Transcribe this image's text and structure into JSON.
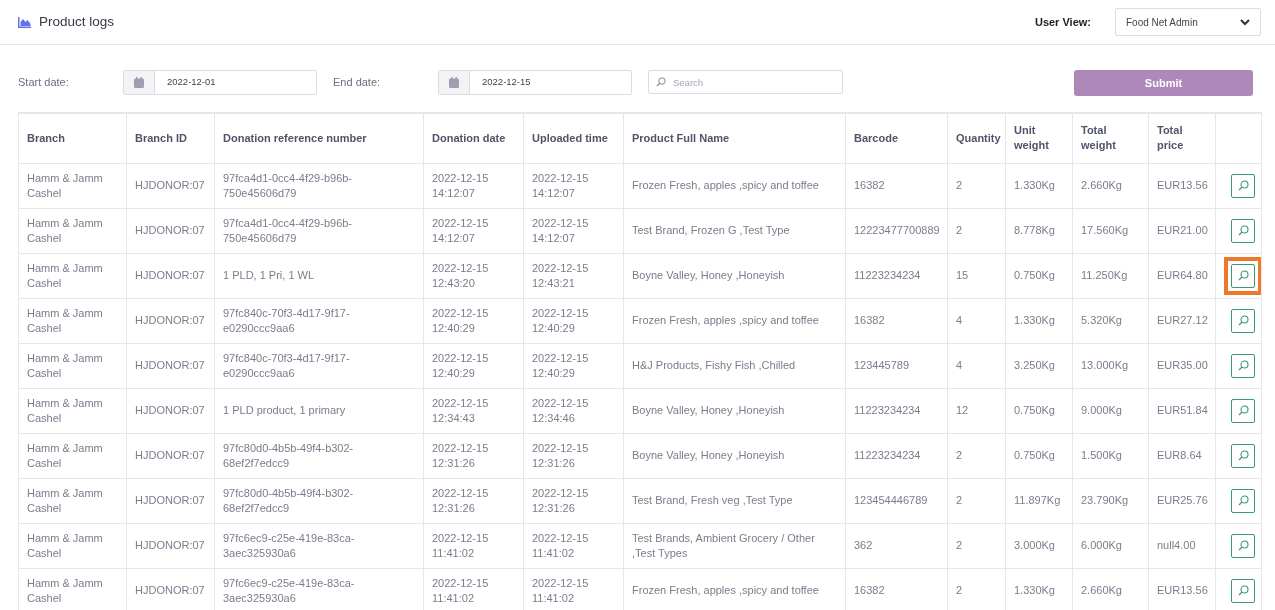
{
  "header": {
    "title": "Product logs",
    "user_view_label": "User View:",
    "user_view_value": "Food Net Admin"
  },
  "filters": {
    "start_label": "Start date:",
    "start_value": "2022-12-01",
    "end_label": "End date:",
    "end_value": "2022-12-15",
    "search_placeholder": "Search",
    "submit": "Submit"
  },
  "table": {
    "columns": [
      "Branch",
      "Branch ID",
      "Donation reference number",
      "Donation date",
      "Uploaded time",
      "Product Full Name",
      "Barcode",
      "Quantity",
      "Unit weight",
      "Total weight",
      "Total price"
    ],
    "rows": [
      {
        "cells": [
          "Hamm & Jamm Cashel",
          "HJDONOR:07",
          "97fca4d1-0cc4-4f29-b96b-750e45606d79",
          "2022-12-15 14:12:07",
          "2022-12-15 14:12:07",
          "Frozen Fresh, apples ,spicy and toffee",
          "16382",
          "2",
          "1.330Kg",
          "2.660Kg",
          "EUR13.56"
        ],
        "highlighted": false
      },
      {
        "cells": [
          "Hamm & Jamm Cashel",
          "HJDONOR:07",
          "97fca4d1-0cc4-4f29-b96b-750e45606d79",
          "2022-12-15 14:12:07",
          "2022-12-15 14:12:07",
          "Test Brand, Frozen G ,Test Type",
          "12223477700889",
          "2",
          "8.778Kg",
          "17.560Kg",
          "EUR21.00"
        ],
        "highlighted": false
      },
      {
        "cells": [
          "Hamm & Jamm Cashel",
          "HJDONOR:07",
          "1 PLD, 1 Pri, 1 WL",
          "2022-12-15 12:43:20",
          "2022-12-15 12:43:21",
          "Boyne Valley, Honey ,Honeyish",
          "11223234234",
          "15",
          "0.750Kg",
          "11.250Kg",
          "EUR64.80"
        ],
        "highlighted": true
      },
      {
        "cells": [
          "Hamm & Jamm Cashel",
          "HJDONOR:07",
          "97fc840c-70f3-4d17-9f17-e0290ccc9aa6",
          "2022-12-15 12:40:29",
          "2022-12-15 12:40:29",
          "Frozen Fresh, apples ,spicy and toffee",
          "16382",
          "4",
          "1.330Kg",
          "5.320Kg",
          "EUR27.12"
        ],
        "highlighted": false
      },
      {
        "cells": [
          "Hamm & Jamm Cashel",
          "HJDONOR:07",
          "97fc840c-70f3-4d17-9f17-e0290ccc9aa6",
          "2022-12-15 12:40:29",
          "2022-12-15 12:40:29",
          "H&J Products, Fishy Fish ,Chilled",
          "123445789",
          "4",
          "3.250Kg",
          "13.000Kg",
          "EUR35.00"
        ],
        "highlighted": false
      },
      {
        "cells": [
          "Hamm & Jamm Cashel",
          "HJDONOR:07",
          "1 PLD product, 1 primary",
          "2022-12-15 12:34:43",
          "2022-12-15 12:34:46",
          "Boyne Valley, Honey ,Honeyish",
          "11223234234",
          "12",
          "0.750Kg",
          "9.000Kg",
          "EUR51.84"
        ],
        "highlighted": false
      },
      {
        "cells": [
          "Hamm & Jamm Cashel",
          "HJDONOR:07",
          "97fc80d0-4b5b-49f4-b302-68ef2f7edcc9",
          "2022-12-15 12:31:26",
          "2022-12-15 12:31:26",
          "Boyne Valley, Honey ,Honeyish",
          "11223234234",
          "2",
          "0.750Kg",
          "1.500Kg",
          "EUR8.64"
        ],
        "highlighted": false
      },
      {
        "cells": [
          "Hamm & Jamm Cashel",
          "HJDONOR:07",
          "97fc80d0-4b5b-49f4-b302-68ef2f7edcc9",
          "2022-12-15 12:31:26",
          "2022-12-15 12:31:26",
          "Test Brand, Fresh veg ,Test Type",
          "123454446789",
          "2",
          "11.897Kg",
          "23.790Kg",
          "EUR25.76"
        ],
        "highlighted": false
      },
      {
        "cells": [
          "Hamm & Jamm Cashel",
          "HJDONOR:07",
          "97fc6ec9-c25e-419e-83ca-3aec325930a6",
          "2022-12-15 11:41:02",
          "2022-12-15 11:41:02",
          "Test Brands, Ambient Grocery / Other ,Test Types",
          "362",
          "2",
          "3.000Kg",
          "6.000Kg",
          "null4.00"
        ],
        "highlighted": false
      },
      {
        "cells": [
          "Hamm & Jamm Cashel",
          "HJDONOR:07",
          "97fc6ec9-c25e-419e-83ca-3aec325930a6",
          "2022-12-15 11:41:02",
          "2022-12-15 11:41:02",
          "Frozen Fresh, apples ,spicy and toffee",
          "16382",
          "2",
          "1.330Kg",
          "2.660Kg",
          "EUR13.56"
        ],
        "highlighted": false
      }
    ]
  }
}
